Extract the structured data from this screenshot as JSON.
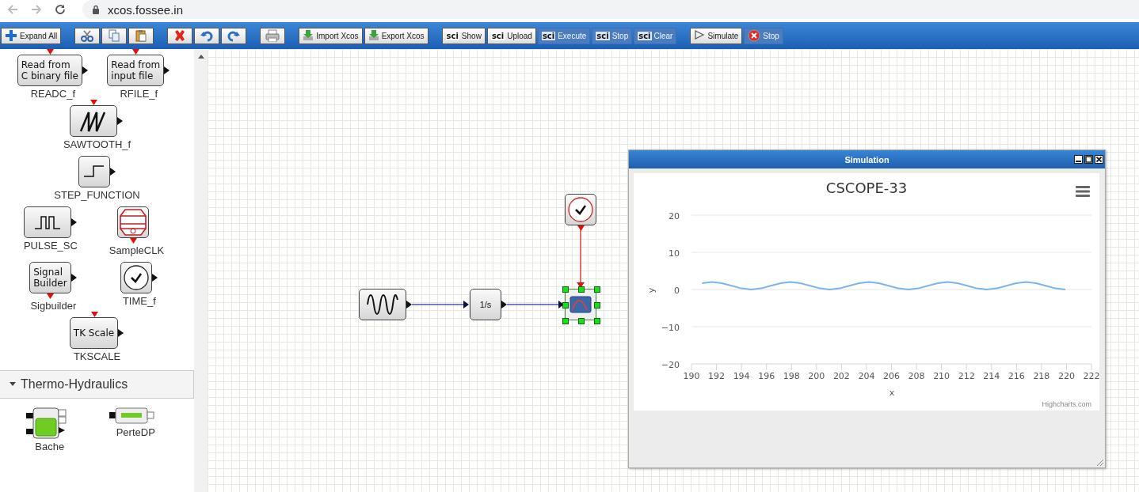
{
  "browser": {
    "url": "xcos.fossee.in"
  },
  "toolbar": {
    "groups": [
      {
        "buttons": [
          {
            "kind": "plus",
            "label": "Expand All",
            "disabled": false
          }
        ]
      },
      {
        "buttons": [
          {
            "kind": "cut",
            "disabled": false
          },
          {
            "kind": "copy",
            "disabled": false
          },
          {
            "kind": "paste",
            "disabled": false
          }
        ]
      },
      {
        "buttons": [
          {
            "kind": "delete",
            "disabled": false
          },
          {
            "kind": "undo",
            "disabled": false
          },
          {
            "kind": "redo",
            "disabled": false
          }
        ]
      },
      {
        "buttons": [
          {
            "kind": "print",
            "disabled": false
          }
        ]
      },
      {
        "buttons": [
          {
            "kind": "import",
            "label": "Import Xcos",
            "disabled": false
          },
          {
            "kind": "export",
            "label": "Export Xcos",
            "disabled": false
          }
        ]
      },
      {
        "buttons": [
          {
            "kind": "sci",
            "badge": "sci",
            "label": "Show",
            "disabled": false
          },
          {
            "kind": "sci",
            "badge": "sci",
            "label": "Upload",
            "disabled": false
          },
          {
            "kind": "sci",
            "badge": "sci",
            "label": "Execute",
            "disabled": true
          },
          {
            "kind": "sci",
            "badge": "sci",
            "label": "Stop",
            "disabled": true
          },
          {
            "kind": "sci",
            "badge": "sci",
            "label": "Clear",
            "disabled": true
          }
        ]
      },
      {
        "buttons": [
          {
            "kind": "play",
            "label": "Simulate",
            "disabled": false
          },
          {
            "kind": "stop",
            "label": "Stop",
            "disabled": true
          }
        ]
      }
    ]
  },
  "palette": {
    "rows": [
      {
        "items": [
          {
            "kind": "text",
            "text": "Read from\nC binary file",
            "label": "READC_f",
            "ports": [
              {
                "kind": "event-in"
              },
              {
                "kind": "out"
              }
            ]
          },
          {
            "kind": "text",
            "text": "Read from\ninput file",
            "label": "RFILE_f",
            "ports": [
              {
                "kind": "event-in"
              },
              {
                "kind": "out"
              }
            ]
          }
        ]
      },
      {
        "items": [
          {
            "kind": "sawtooth",
            "label": "SAWTOOTH_f",
            "ports": [
              {
                "kind": "event-in"
              },
              {
                "kind": "out"
              }
            ]
          }
        ]
      },
      {
        "items": [
          {
            "kind": "step",
            "label": "STEP_FUNCTION",
            "ports": [
              {
                "kind": "out"
              }
            ]
          }
        ]
      },
      {
        "items": [
          {
            "kind": "pulse",
            "label": "PULSE_SC",
            "ports": [
              {
                "kind": "out"
              }
            ]
          },
          {
            "kind": "sampleclk",
            "label": "SampleCLK",
            "ports": [
              {
                "kind": "event-out"
              }
            ]
          }
        ]
      },
      {
        "items": [
          {
            "kind": "text",
            "text": "Signal\nBuilder",
            "label": "Sigbuilder",
            "ports": [
              {
                "kind": "event-out"
              },
              {
                "kind": "out"
              }
            ]
          },
          {
            "kind": "clock",
            "label": "TIME_f",
            "ports": [
              {
                "kind": "out"
              }
            ]
          }
        ]
      },
      {
        "items": [
          {
            "kind": "text",
            "text": "TK Scale",
            "label": "TKSCALE",
            "ports": [
              {
                "kind": "event-in"
              },
              {
                "kind": "out"
              }
            ]
          }
        ]
      }
    ],
    "sections": [
      {
        "title": "Thermo-Hydraulics",
        "expanded": true,
        "rows": [
          {
            "items": [
              {
                "kind": "tank",
                "label": "Bache"
              },
              {
                "kind": "pipe",
                "label": "PerteDP"
              }
            ]
          }
        ]
      }
    ]
  },
  "diagram": {
    "blocks": [
      {
        "kind": "sine",
        "selected": false
      },
      {
        "kind": "text",
        "text": "1/s",
        "selected": false
      },
      {
        "kind": "clock",
        "selected": false
      },
      {
        "kind": "scope",
        "selected": true
      }
    ]
  },
  "simulation_window": {
    "title": "Simulation",
    "credit": "Highcharts.com",
    "chart_data": {
      "type": "line",
      "title": "CSCOPE-33",
      "xlabel": "x",
      "ylabel": "y",
      "grid": true,
      "x": [
        190.85,
        191.64,
        192.42,
        193.21,
        193.99,
        194.78,
        195.56,
        196.35,
        197.14,
        197.92,
        198.71,
        199.49,
        200.28,
        201.06,
        201.85,
        202.63,
        203.42,
        204.2,
        204.99,
        205.77,
        206.56,
        207.35,
        208.13,
        208.92,
        209.7,
        210.49,
        211.27,
        212.06,
        212.84,
        213.63,
        214.41,
        215.2,
        215.98,
        216.77,
        217.56,
        218.34,
        219.13,
        219.91
      ],
      "series": [
        {
          "color": "#7cb5ec",
          "values": [
            1.7,
            2,
            1.7,
            1,
            0.3,
            0,
            0.3,
            1,
            1.7,
            2,
            1.7,
            1,
            0.3,
            0,
            0.3,
            1,
            1.7,
            2,
            1.7,
            1,
            0.3,
            0,
            0.3,
            1,
            1.7,
            2,
            1.7,
            1,
            0.3,
            0,
            0.3,
            1,
            1.7,
            2,
            1.7,
            1,
            0.3,
            0
          ]
        }
      ],
      "xlim": [
        190,
        222
      ],
      "ylim": [
        -20,
        20
      ],
      "xticks": [
        190,
        192,
        194,
        196,
        198,
        200,
        202,
        204,
        206,
        208,
        210,
        212,
        214,
        216,
        218,
        220,
        222
      ],
      "yticks": [
        -20,
        -10,
        0,
        10,
        20
      ]
    }
  }
}
